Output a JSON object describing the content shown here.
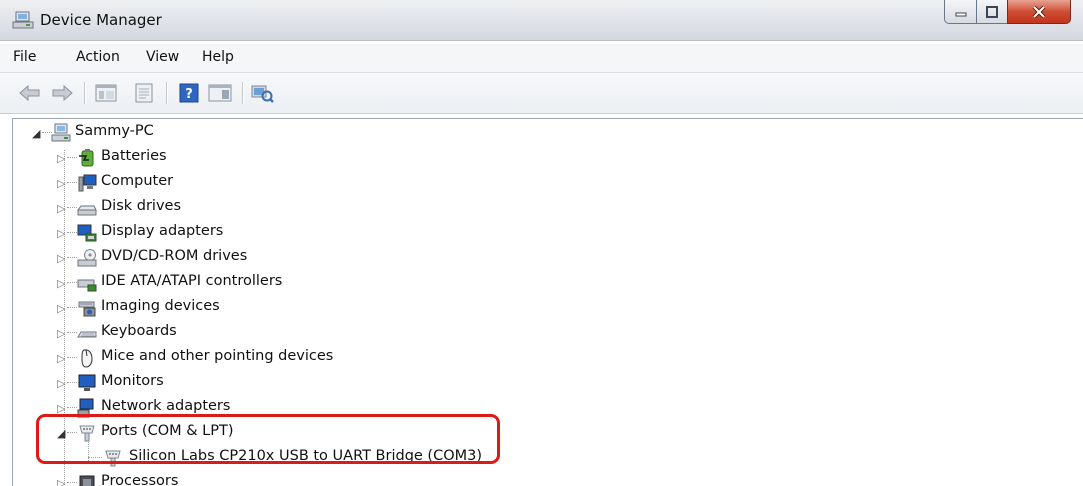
{
  "window": {
    "title": "Device Manager"
  },
  "menu": [
    "File",
    "Action",
    "View",
    "Help"
  ],
  "toolbar": {
    "buttons": [
      "back-arrow-icon",
      "forward-arrow-icon",
      "console-tree-icon",
      "properties-icon",
      "help-icon",
      "action-pane-icon",
      "scan-hardware-icon"
    ]
  },
  "tree": {
    "root": {
      "label": "Sammy-PC",
      "icon": "computer-icon"
    },
    "categories": [
      {
        "label": "Batteries",
        "icon": "battery-icon"
      },
      {
        "label": "Computer",
        "icon": "computer-icon"
      },
      {
        "label": "Disk drives",
        "icon": "disk-drive-icon"
      },
      {
        "label": "Display adapters",
        "icon": "display-adapter-icon"
      },
      {
        "label": "DVD/CD-ROM drives",
        "icon": "dvd-drive-icon"
      },
      {
        "label": "IDE ATA/ATAPI controllers",
        "icon": "ide-controller-icon"
      },
      {
        "label": "Imaging devices",
        "icon": "camera-icon"
      },
      {
        "label": "Keyboards",
        "icon": "keyboard-icon"
      },
      {
        "label": "Mice and other pointing devices",
        "icon": "mouse-icon"
      },
      {
        "label": "Monitors",
        "icon": "monitor-icon"
      },
      {
        "label": "Network adapters",
        "icon": "network-adapter-icon"
      },
      {
        "label": "Ports (COM & LPT)",
        "icon": "port-icon",
        "expanded": true
      },
      {
        "label": "Processors",
        "icon": "processor-icon"
      }
    ],
    "ports_children": [
      {
        "label": "Silicon Labs CP210x USB to UART Bridge (COM3)",
        "icon": "port-icon"
      }
    ]
  },
  "colors": {
    "highlight": "#e01818",
    "close_button": "#c2331a"
  }
}
